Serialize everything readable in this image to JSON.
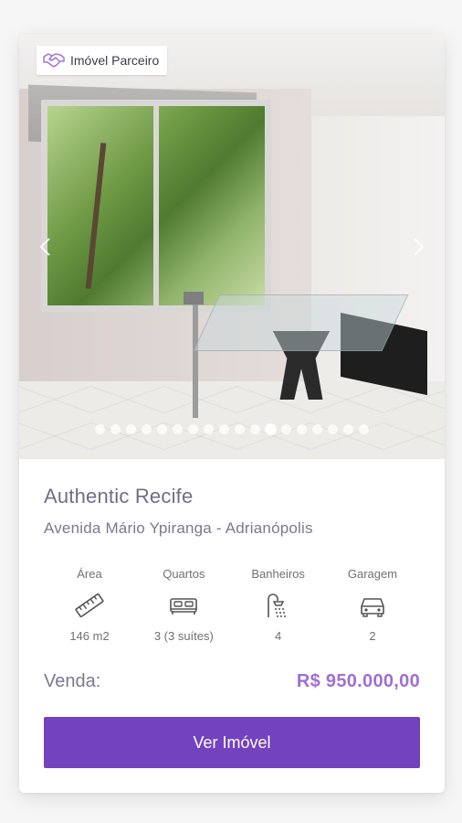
{
  "listing": {
    "badge_label": "Imóvel Parceiro",
    "title": "Authentic Recife",
    "address": "Avenida Mário Ypiranga - Adrianópolis",
    "carousel": {
      "total_slides": 18,
      "active_slide": 11
    },
    "features": [
      {
        "label": "Área",
        "value": "146 m2",
        "icon": "ruler-icon"
      },
      {
        "label": "Quartos",
        "value": "3 (3 suítes)",
        "icon": "bed-icon"
      },
      {
        "label": "Banheiros",
        "value": "4",
        "icon": "shower-icon"
      },
      {
        "label": "Garagem",
        "value": "2",
        "icon": "car-icon"
      }
    ],
    "sale_label": "Venda:",
    "price": "R$ 950.000,00",
    "cta_label": "Ver Imóvel"
  },
  "colors": {
    "accent": "#7342be",
    "price": "#9e6fd4",
    "title": "#6f6d86"
  }
}
